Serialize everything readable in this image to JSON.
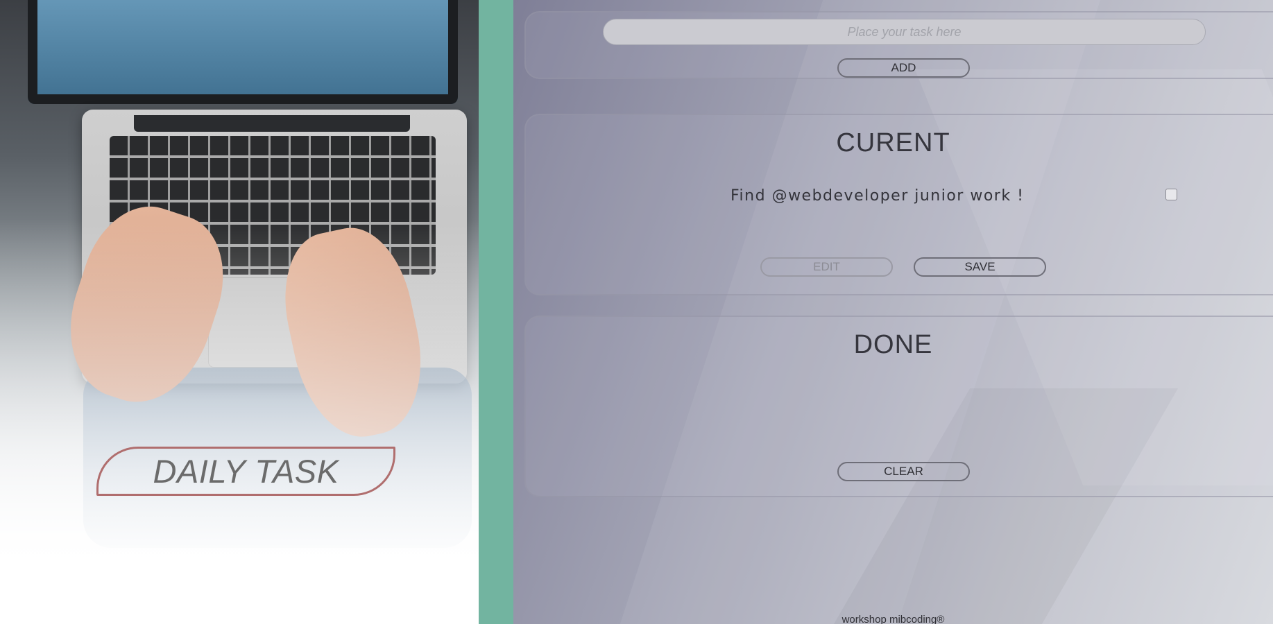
{
  "hero": {
    "title": "DAILY TASK",
    "image": "laptop-typing-photo"
  },
  "task_input": {
    "placeholder": "Place your task here",
    "value": ""
  },
  "buttons": {
    "add": "ADD",
    "edit": "EDIT",
    "save": "SAVE",
    "clear": "CLEAR"
  },
  "current": {
    "title": "CURENT",
    "tasks": [
      {
        "text": "Find @webdeveloper junior work !",
        "checked": false
      }
    ]
  },
  "done": {
    "title": "DONE",
    "tasks": []
  },
  "footer": {
    "text": "workshop mibcoding®"
  },
  "colors": {
    "accent_green": "#72b4a0",
    "hero_border": "#b06e6e",
    "panel_bg": "#a7a8b8"
  }
}
